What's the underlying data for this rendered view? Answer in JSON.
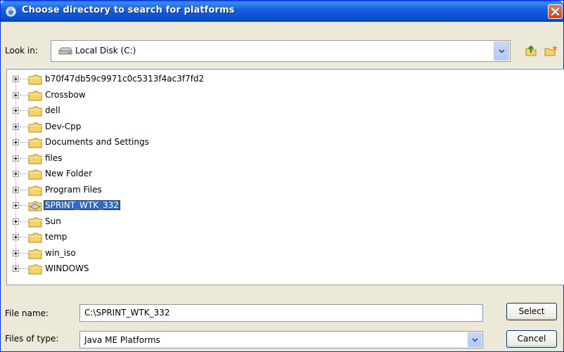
{
  "window": {
    "title": "Choose directory to search for platforms"
  },
  "lookin": {
    "label": "Look in:",
    "value": "Local Disk (C:)",
    "icon": "drive-icon"
  },
  "toolbar": {
    "up_icon": "up-one-level-icon",
    "new_folder_icon": "new-folder-icon"
  },
  "tree": {
    "items": [
      {
        "label": "b70f47db59c9971c0c5313f4ac3f7fd2",
        "selected": false
      },
      {
        "label": "Crossbow",
        "selected": false
      },
      {
        "label": "dell",
        "selected": false
      },
      {
        "label": "Dev-Cpp",
        "selected": false
      },
      {
        "label": "Documents and Settings",
        "selected": false
      },
      {
        "label": "files",
        "selected": false
      },
      {
        "label": "New Folder",
        "selected": false
      },
      {
        "label": "Program Files",
        "selected": false
      },
      {
        "label": "SPRINT_WTK_332",
        "selected": true
      },
      {
        "label": "Sun",
        "selected": false
      },
      {
        "label": "temp",
        "selected": false
      },
      {
        "label": "win_iso",
        "selected": false
      },
      {
        "label": "WINDOWS",
        "selected": false
      }
    ]
  },
  "file_name": {
    "label": "File name:",
    "value": "C:\\SPRINT_WTK_332"
  },
  "file_type": {
    "label": "Files of type:",
    "value": "Java ME Platforms"
  },
  "buttons": {
    "select": "Select",
    "cancel": "Cancel"
  },
  "colors": {
    "titlebar": "#0a4ccc",
    "selection": "#316ac5",
    "dialog_bg": "#ece9d8",
    "folder": "#f5d36b"
  }
}
